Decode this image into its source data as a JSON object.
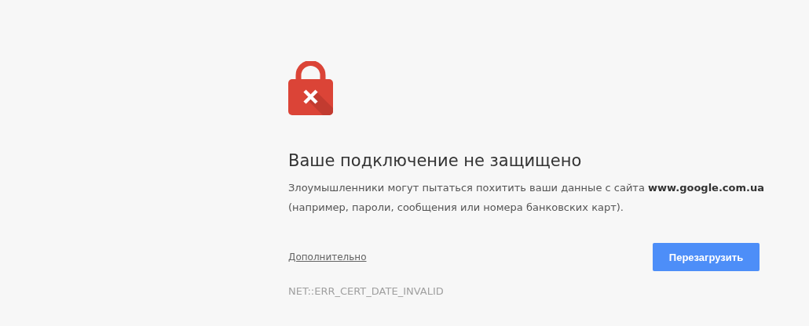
{
  "title": "Ваше подключение не защищено",
  "message": "Злоумышленники могут пытаться похитить ваши данные с сайта **www.google.com.ua** (например, пароли, сообщения или номера банковских карт).",
  "details_link": "Дополнительно",
  "reload_button": "Перезагрузить",
  "error_code": "NET::ERR_CERT_DATE_INVALID"
}
